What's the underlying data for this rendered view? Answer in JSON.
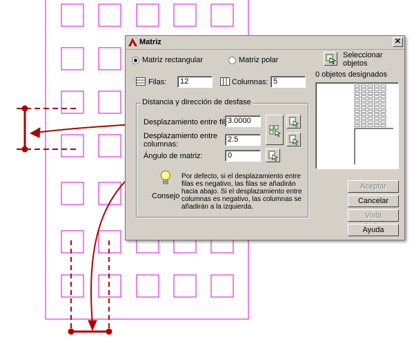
{
  "dialog": {
    "title": "Matriz",
    "mode": {
      "rectangular_label": "Matriz rectangular",
      "polar_label": "Matriz polar",
      "selected": "rectangular"
    },
    "rows_label": "Filas:",
    "rows_value": "12",
    "columns_label": "Columnas:",
    "columns_value": "5",
    "select_objects_label": "Seleccionar objetos",
    "objects_selected": "0 objetos designados",
    "offset_group": {
      "title": "Distancia y dirección de desfase",
      "row_offset_label": "Desplazamiento entre filas:",
      "row_offset_value": "3.0000",
      "col_offset_label": "Desplazamiento entre columnas:",
      "col_offset_value": "2.5",
      "angle_label": "Ángulo de matriz:",
      "angle_value": "0"
    },
    "tip": {
      "label": "Consejo",
      "text": "Por defecto, si el desplazamiento entre filas es negativo, las filas se añadirán hacia abajo. Si el desplazamiento entre columnas es negativo, las columnas se añadirán a la izquierda."
    },
    "buttons": {
      "accept": "Aceptar",
      "cancel": "Cancelar",
      "preview": "Vista preliminar <",
      "help": "Ayuda"
    }
  },
  "colors": {
    "drawing_magenta": "#e000e0",
    "annotation_red": "#b00000",
    "dialog_face": "#d4d0c8"
  }
}
